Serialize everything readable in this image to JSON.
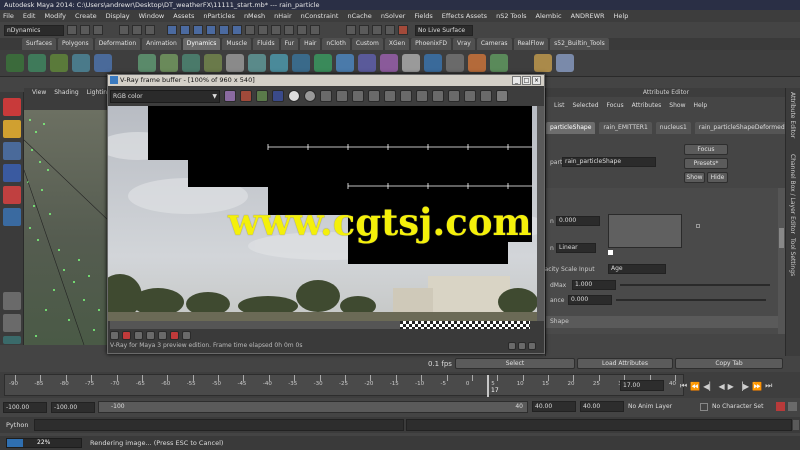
{
  "window": {
    "title": "Autodesk Maya 2014: C:\\Users\\andrewr\\Desktop\\DT_weatherFX\\11111_start.mb*  ---  rain_particle"
  },
  "menubar": [
    "File",
    "Edit",
    "Modify",
    "Create",
    "Display",
    "Window",
    "Assets",
    "nParticles",
    "nMesh",
    "nHair",
    "nConstraint",
    "nCache",
    "nSolver",
    "Fields",
    "Effects Assets",
    "nS2 Tools",
    "Alembic",
    "ANDREWR",
    "Help"
  ],
  "statusline": {
    "mode": "nDynamics",
    "live_surface": "No Live Surface"
  },
  "shelf_tabs": [
    "Surfaces",
    "Polygons",
    "Deformation",
    "Animation",
    "Dynamics",
    "Muscle",
    "Fluids",
    "Fur",
    "Hair",
    "nCloth",
    "Custom",
    "XGen",
    "PhoenixFD",
    "Vray",
    "Cameras",
    "RealFlow",
    "s52_Builtin_Tools"
  ],
  "shelf_active": "Dynamics",
  "viewport": {
    "menu": [
      "View",
      "Shading",
      "Lighting"
    ]
  },
  "render_view": {
    "title": "V-Ray frame buffer - [100% of 960 x 540]",
    "channel": "RGB color",
    "status": "V-Ray for Maya 3 preview edition. Frame time elapsed 0h 0m 0s"
  },
  "watermark": "www.cgtsj.com",
  "attribute_editor": {
    "title": "Attribute Editor",
    "menu": [
      "List",
      "Selected",
      "Focus",
      "Attributes",
      "Show",
      "Help"
    ],
    "tabs": [
      "particleShape",
      "rain_EMITTER1",
      "nucleus1",
      "rain_particleShapeDeformed"
    ],
    "node_label": "particle:",
    "node_value": "rain_particleShape",
    "buttons": [
      "Focus",
      "Presets*",
      "Show",
      "Hide"
    ],
    "rows": [
      {
        "label": "n",
        "value": "0.000"
      },
      {
        "label": "n",
        "value": "Linear"
      },
      {
        "label": "Opacity Scale Input",
        "value": "Age"
      },
      {
        "label": "dMax",
        "value": "1.000"
      },
      {
        "label": "ance",
        "value": "0.000"
      }
    ],
    "section": "Shape",
    "bottom_buttons": [
      "Select",
      "Load Attributes",
      "Copy Tab"
    ]
  },
  "side_tabs": [
    "Attribute Editor",
    "Channel Box / Layer Editor",
    "Tool Settings"
  ],
  "timeline": {
    "ticks": [
      "-90",
      "-85",
      "-80",
      "-75",
      "-70",
      "-65",
      "-60",
      "-55",
      "-50",
      "-45",
      "-40",
      "-35",
      "-30",
      "-25",
      "-20",
      "-15",
      "-10",
      "-5",
      "0",
      "5",
      "10",
      "15",
      "20",
      "25",
      "30",
      "35",
      "40"
    ],
    "current_frame_marker": "17",
    "current_frame": "17.00",
    "fps": "0.1 fps"
  },
  "range": {
    "start": "-100.00",
    "playback_start": "-100.00",
    "range_label": "-100",
    "range_end_label": "40",
    "playback_end": "40.00",
    "end": "40.00",
    "anim_layer": "No Anim Layer",
    "character_set": "No Character Set"
  },
  "command_line": {
    "language": "Python"
  },
  "help_line": {
    "progress": "22%",
    "message": "Rendering image... (Press ESC to Cancel)"
  },
  "colors": {
    "sky": "#c9ccd1",
    "panel": "#444444",
    "watermark": "#f4f00a",
    "title_bar": "#2a2f45"
  }
}
